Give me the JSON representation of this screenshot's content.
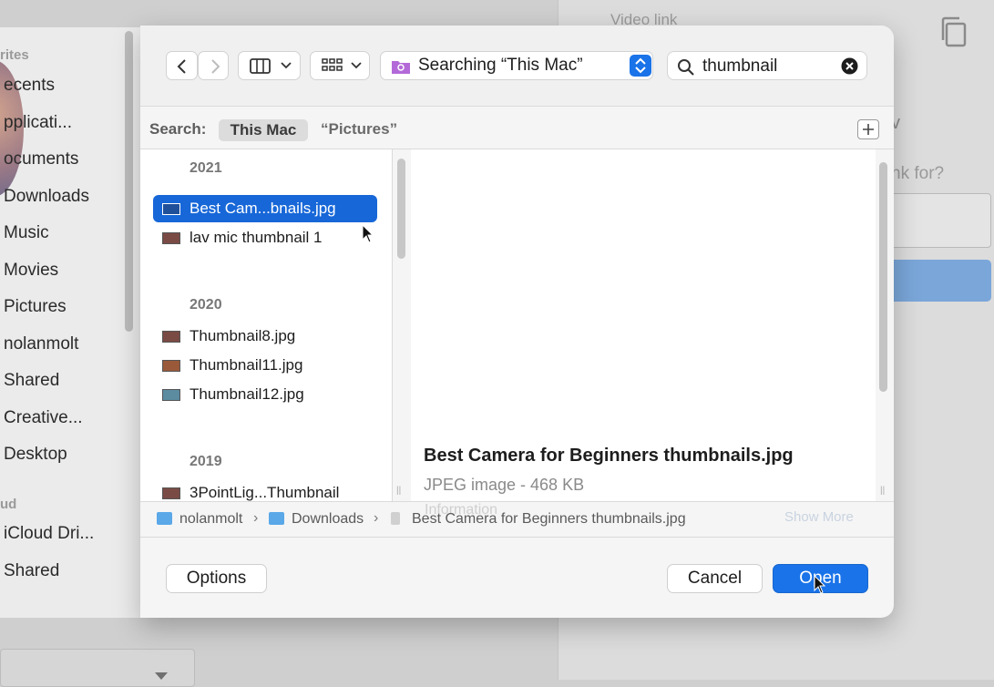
{
  "background": {
    "video_link_label": "Video link",
    "letter_v": "v",
    "question_fragment": "nk for?"
  },
  "sidebar": {
    "favorites_header": "rites",
    "items": [
      "ecents",
      "pplicati...",
      "ocuments",
      "Downloads",
      "Music",
      "Movies",
      "Pictures",
      "nolanmolt",
      "Shared",
      "Creative...",
      "Desktop"
    ],
    "icloud_header": "ud",
    "icloud_items": [
      "iCloud Dri...",
      "Shared"
    ]
  },
  "toolbar": {
    "location_label": "Searching “This Mac”",
    "search_value": "thumbnail"
  },
  "scope": {
    "label": "Search:",
    "selected": "This Mac",
    "other": "“Pictures”"
  },
  "file_list": {
    "groups": [
      {
        "year": "2021",
        "files": [
          "Best Cam...bnails.jpg",
          "lav mic thumbnail 1"
        ]
      },
      {
        "year": "2020",
        "files": [
          "Thumbnail8.jpg",
          "Thumbnail11.jpg",
          "Thumbnail12.jpg"
        ]
      },
      {
        "year": "2019",
        "files": [
          "3PointLig...Thumbnail"
        ]
      }
    ],
    "selected_file": "Best Cam...bnails.jpg"
  },
  "preview": {
    "title": "Best Camera for Beginners thumbnails.jpg",
    "kind": "JPEG image - 468 KB",
    "information_label": "Information",
    "show_more": "Show More"
  },
  "path_bar": {
    "crumbs": [
      "nolanmolt",
      "Downloads",
      "Best Camera for Beginners thumbnails.jpg"
    ]
  },
  "buttons": {
    "options": "Options",
    "cancel": "Cancel",
    "open": "Open"
  },
  "colors": {
    "accent": "#1a73e8",
    "selection": "#1767d8"
  }
}
